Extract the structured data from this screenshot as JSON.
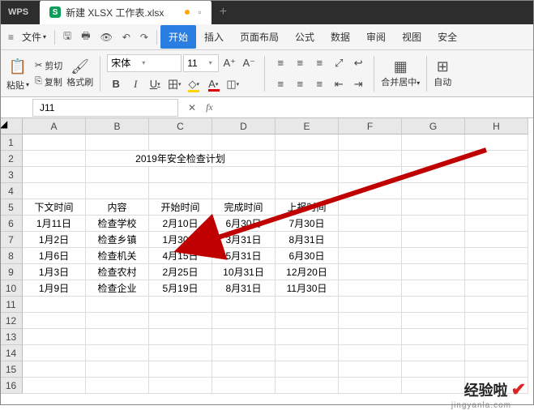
{
  "titlebar": {
    "logo": "WPS",
    "filename": "新建 XLSX 工作表.xlsx"
  },
  "menubar": {
    "file_label": "文件",
    "tabs": [
      "开始",
      "插入",
      "页面布局",
      "公式",
      "数据",
      "审阅",
      "视图",
      "安全"
    ]
  },
  "toolbar": {
    "paste": "粘贴",
    "cut": "剪切",
    "copy": "复制",
    "format_brush": "格式刷",
    "font_name": "宋体",
    "font_size": "11",
    "merge": "合并居中",
    "auto": "自动"
  },
  "namebox": {
    "cell_ref": "J11"
  },
  "sheet": {
    "cols": [
      "A",
      "B",
      "C",
      "D",
      "E",
      "F",
      "G",
      "H"
    ],
    "rows": [
      "1",
      "2",
      "3",
      "4",
      "5",
      "6",
      "7",
      "8",
      "9",
      "10",
      "11",
      "12",
      "13",
      "14",
      "15",
      "16"
    ],
    "title": "2019年安全检查计划",
    "headers": [
      "下文时间",
      "内容",
      "开始时间",
      "完成时间",
      "上报时间"
    ],
    "data": [
      [
        "1月11日",
        "检查学校",
        "2月10日",
        "6月30日",
        "7月30日"
      ],
      [
        "1月2日",
        "检查乡镇",
        "1月30日",
        "3月31日",
        "8月31日"
      ],
      [
        "1月6日",
        "检查机关",
        "4月15日",
        "5月31日",
        "6月30日"
      ],
      [
        "1月3日",
        "检查农村",
        "2月25日",
        "10月31日",
        "12月20日"
      ],
      [
        "1月9日",
        "检查企业",
        "5月19日",
        "8月31日",
        "11月30日"
      ]
    ]
  },
  "watermark": {
    "text": "经验啦",
    "sub": "jingyanla.com"
  }
}
